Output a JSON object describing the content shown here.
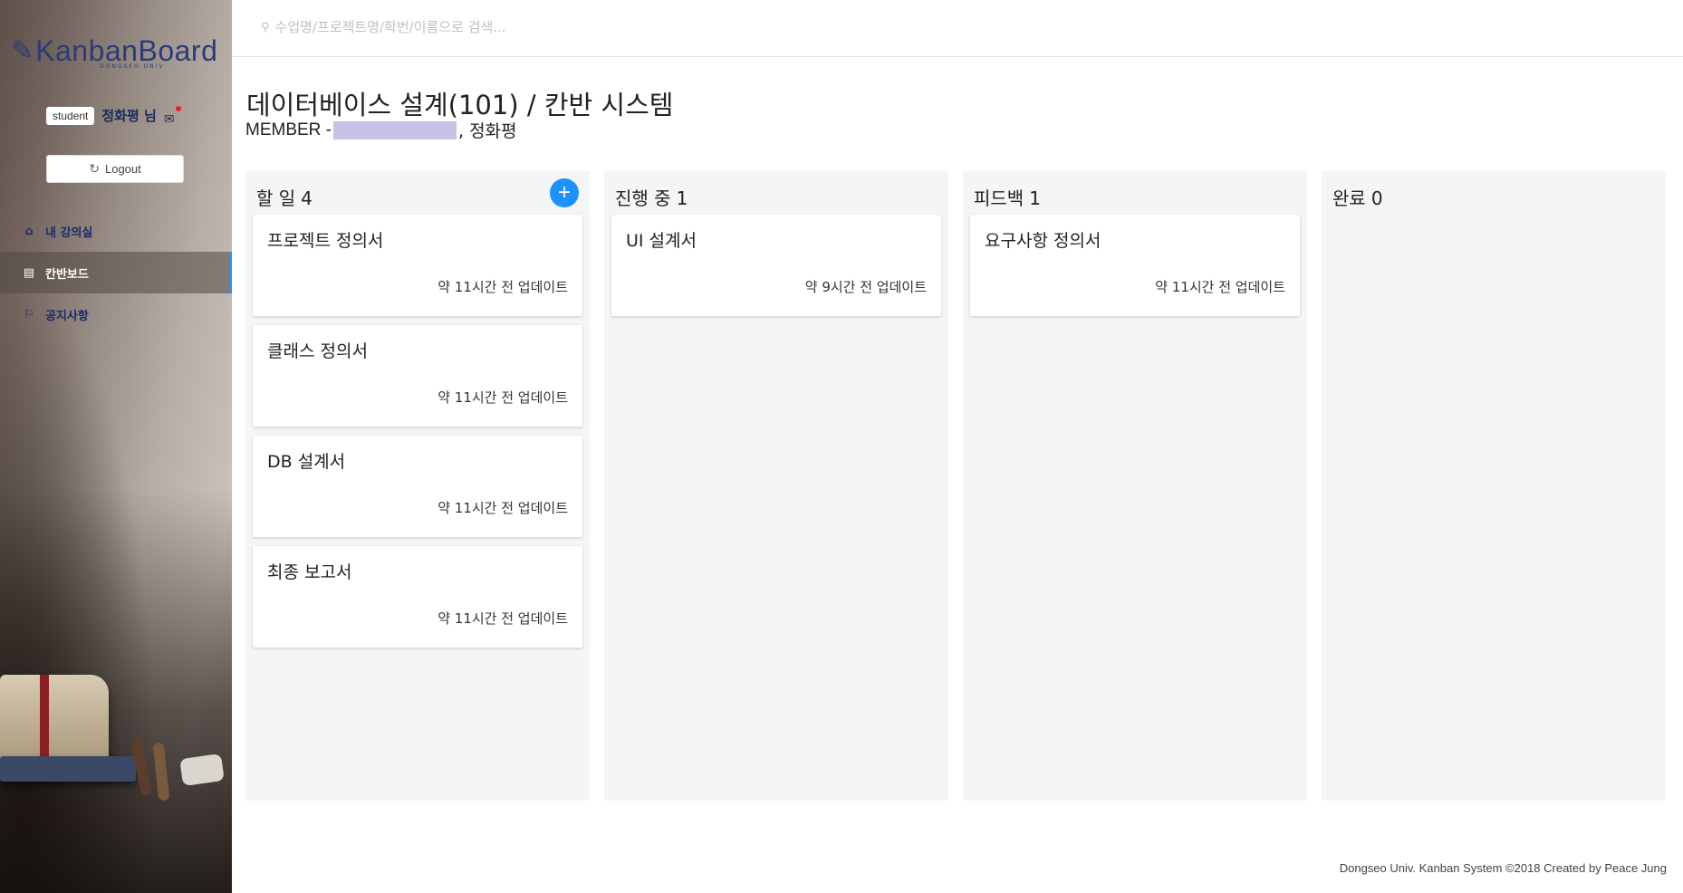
{
  "app": {
    "logo_text": "KanbanBoard",
    "logo_sub": "DONGSEO UNIV",
    "accent_color": "#1e90ff",
    "brand_color": "#2b3a7a"
  },
  "user": {
    "role_badge": "student",
    "name": "정화평 님",
    "logout_label": "Logout"
  },
  "sidebar": {
    "items": [
      {
        "label": "내 강의실",
        "icon": "home-icon"
      },
      {
        "label": "칸반보드",
        "icon": "board-icon"
      },
      {
        "label": "공지사항",
        "icon": "flag-icon"
      }
    ]
  },
  "search": {
    "placeholder": "수업명/프로젝트명/학번/이름으로 검색..."
  },
  "header": {
    "title": "데이터베이스 설계(101) / 칸반 시스템",
    "member_label": "MEMBER - ",
    "member_visible": ", 정화평"
  },
  "board": {
    "columns": [
      {
        "title": "할 일",
        "count": "4",
        "cards": [
          {
            "title": "프로젝트 정의서",
            "time": "약 11시간 전 업데이트"
          },
          {
            "title": "클래스 정의서",
            "time": "약 11시간 전 업데이트"
          },
          {
            "title": "DB 설계서",
            "time": "약 11시간 전 업데이트"
          },
          {
            "title": "최종 보고서",
            "time": "약 11시간 전 업데이트"
          }
        ]
      },
      {
        "title": "진행 중",
        "count": "1",
        "cards": [
          {
            "title": "UI 설계서",
            "time": "약 9시간 전 업데이트"
          }
        ]
      },
      {
        "title": "피드백",
        "count": "1",
        "cards": [
          {
            "title": "요구사항 정의서",
            "time": "약 11시간 전 업데이트"
          }
        ]
      },
      {
        "title": "완료",
        "count": "0",
        "cards": []
      }
    ]
  },
  "footer": {
    "text": "Dongseo Univ. Kanban System ©2018 Created by Peace Jung"
  }
}
